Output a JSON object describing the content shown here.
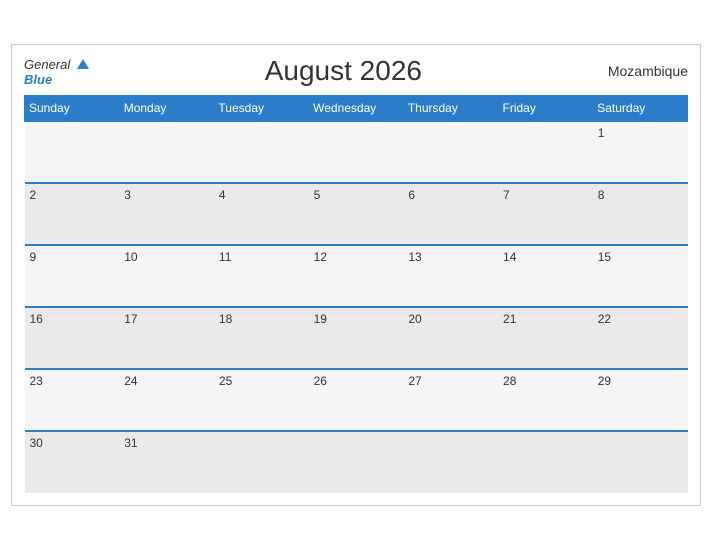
{
  "header": {
    "logo_general": "General",
    "logo_blue": "Blue",
    "title": "August 2026",
    "country": "Mozambique"
  },
  "days_of_week": [
    "Sunday",
    "Monday",
    "Tuesday",
    "Wednesday",
    "Thursday",
    "Friday",
    "Saturday"
  ],
  "weeks": [
    [
      "",
      "",
      "",
      "",
      "",
      "",
      "1"
    ],
    [
      "2",
      "3",
      "4",
      "5",
      "6",
      "7",
      "8"
    ],
    [
      "9",
      "10",
      "11",
      "12",
      "13",
      "14",
      "15"
    ],
    [
      "16",
      "17",
      "18",
      "19",
      "20",
      "21",
      "22"
    ],
    [
      "23",
      "24",
      "25",
      "26",
      "27",
      "28",
      "29"
    ],
    [
      "30",
      "31",
      "",
      "",
      "",
      "",
      ""
    ]
  ]
}
